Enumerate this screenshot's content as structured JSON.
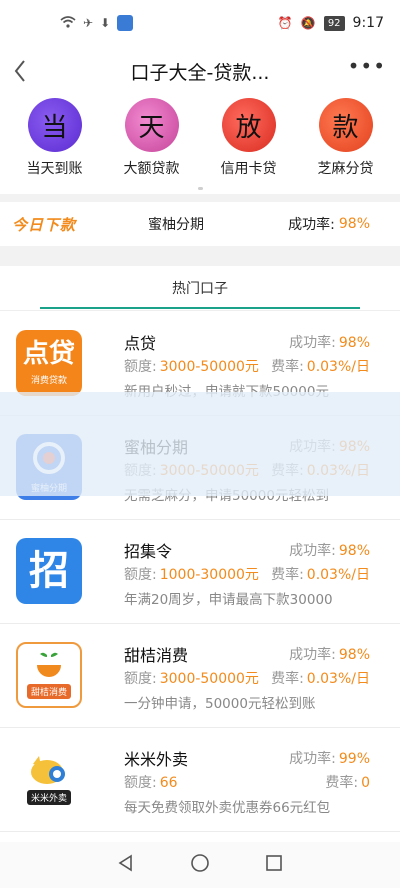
{
  "status": {
    "time": "9:17",
    "battery": "92"
  },
  "nav": {
    "title": "口子大全-贷款..."
  },
  "quick": [
    {
      "char": "当",
      "label": "当天到账"
    },
    {
      "char": "天",
      "label": "大额贷款"
    },
    {
      "char": "放",
      "label": "信用卡贷"
    },
    {
      "char": "款",
      "label": "芝麻分贷"
    }
  ],
  "today": {
    "badge": "今日下款",
    "name": "蜜柚分期",
    "rate_label": "成功率:",
    "rate": "98%"
  },
  "tab": {
    "label": "热门口子"
  },
  "labels": {
    "success": "成功率:",
    "quota": "额度:",
    "fee": "费率:"
  },
  "products": [
    {
      "logo_big": "点贷",
      "logo_small": "消费贷款",
      "name": "点贷",
      "rate": "98%",
      "quota": "3000-50000元",
      "fee": "0.03%/日",
      "desc": "新用户秒过，申请就下款50000元"
    },
    {
      "logo_big": "",
      "logo_small": "蜜柚分期",
      "name": "蜜柚分期",
      "rate": "98%",
      "quota": "3000-50000元",
      "fee": "0.03%/日",
      "desc": "无需芝麻分，申请50000元轻松到"
    },
    {
      "logo_big": "招",
      "logo_small": "",
      "name": "招集令",
      "rate": "98%",
      "quota": "1000-30000元",
      "fee": "0.03%/日",
      "desc": "年满20周岁，申请最高下款30000"
    },
    {
      "logo_big": "",
      "logo_small": "甜桔消费",
      "name": "甜桔消费",
      "rate": "98%",
      "quota": "3000-50000元",
      "fee": "0.03%/日",
      "desc": "一分钟申请，50000元轻松到账"
    },
    {
      "logo_big": "",
      "logo_small": "米米外卖",
      "name": "米米外卖",
      "rate": "99%",
      "quota": "66",
      "fee": "0",
      "desc": "每天免费领取外卖优惠券66元红包"
    }
  ]
}
